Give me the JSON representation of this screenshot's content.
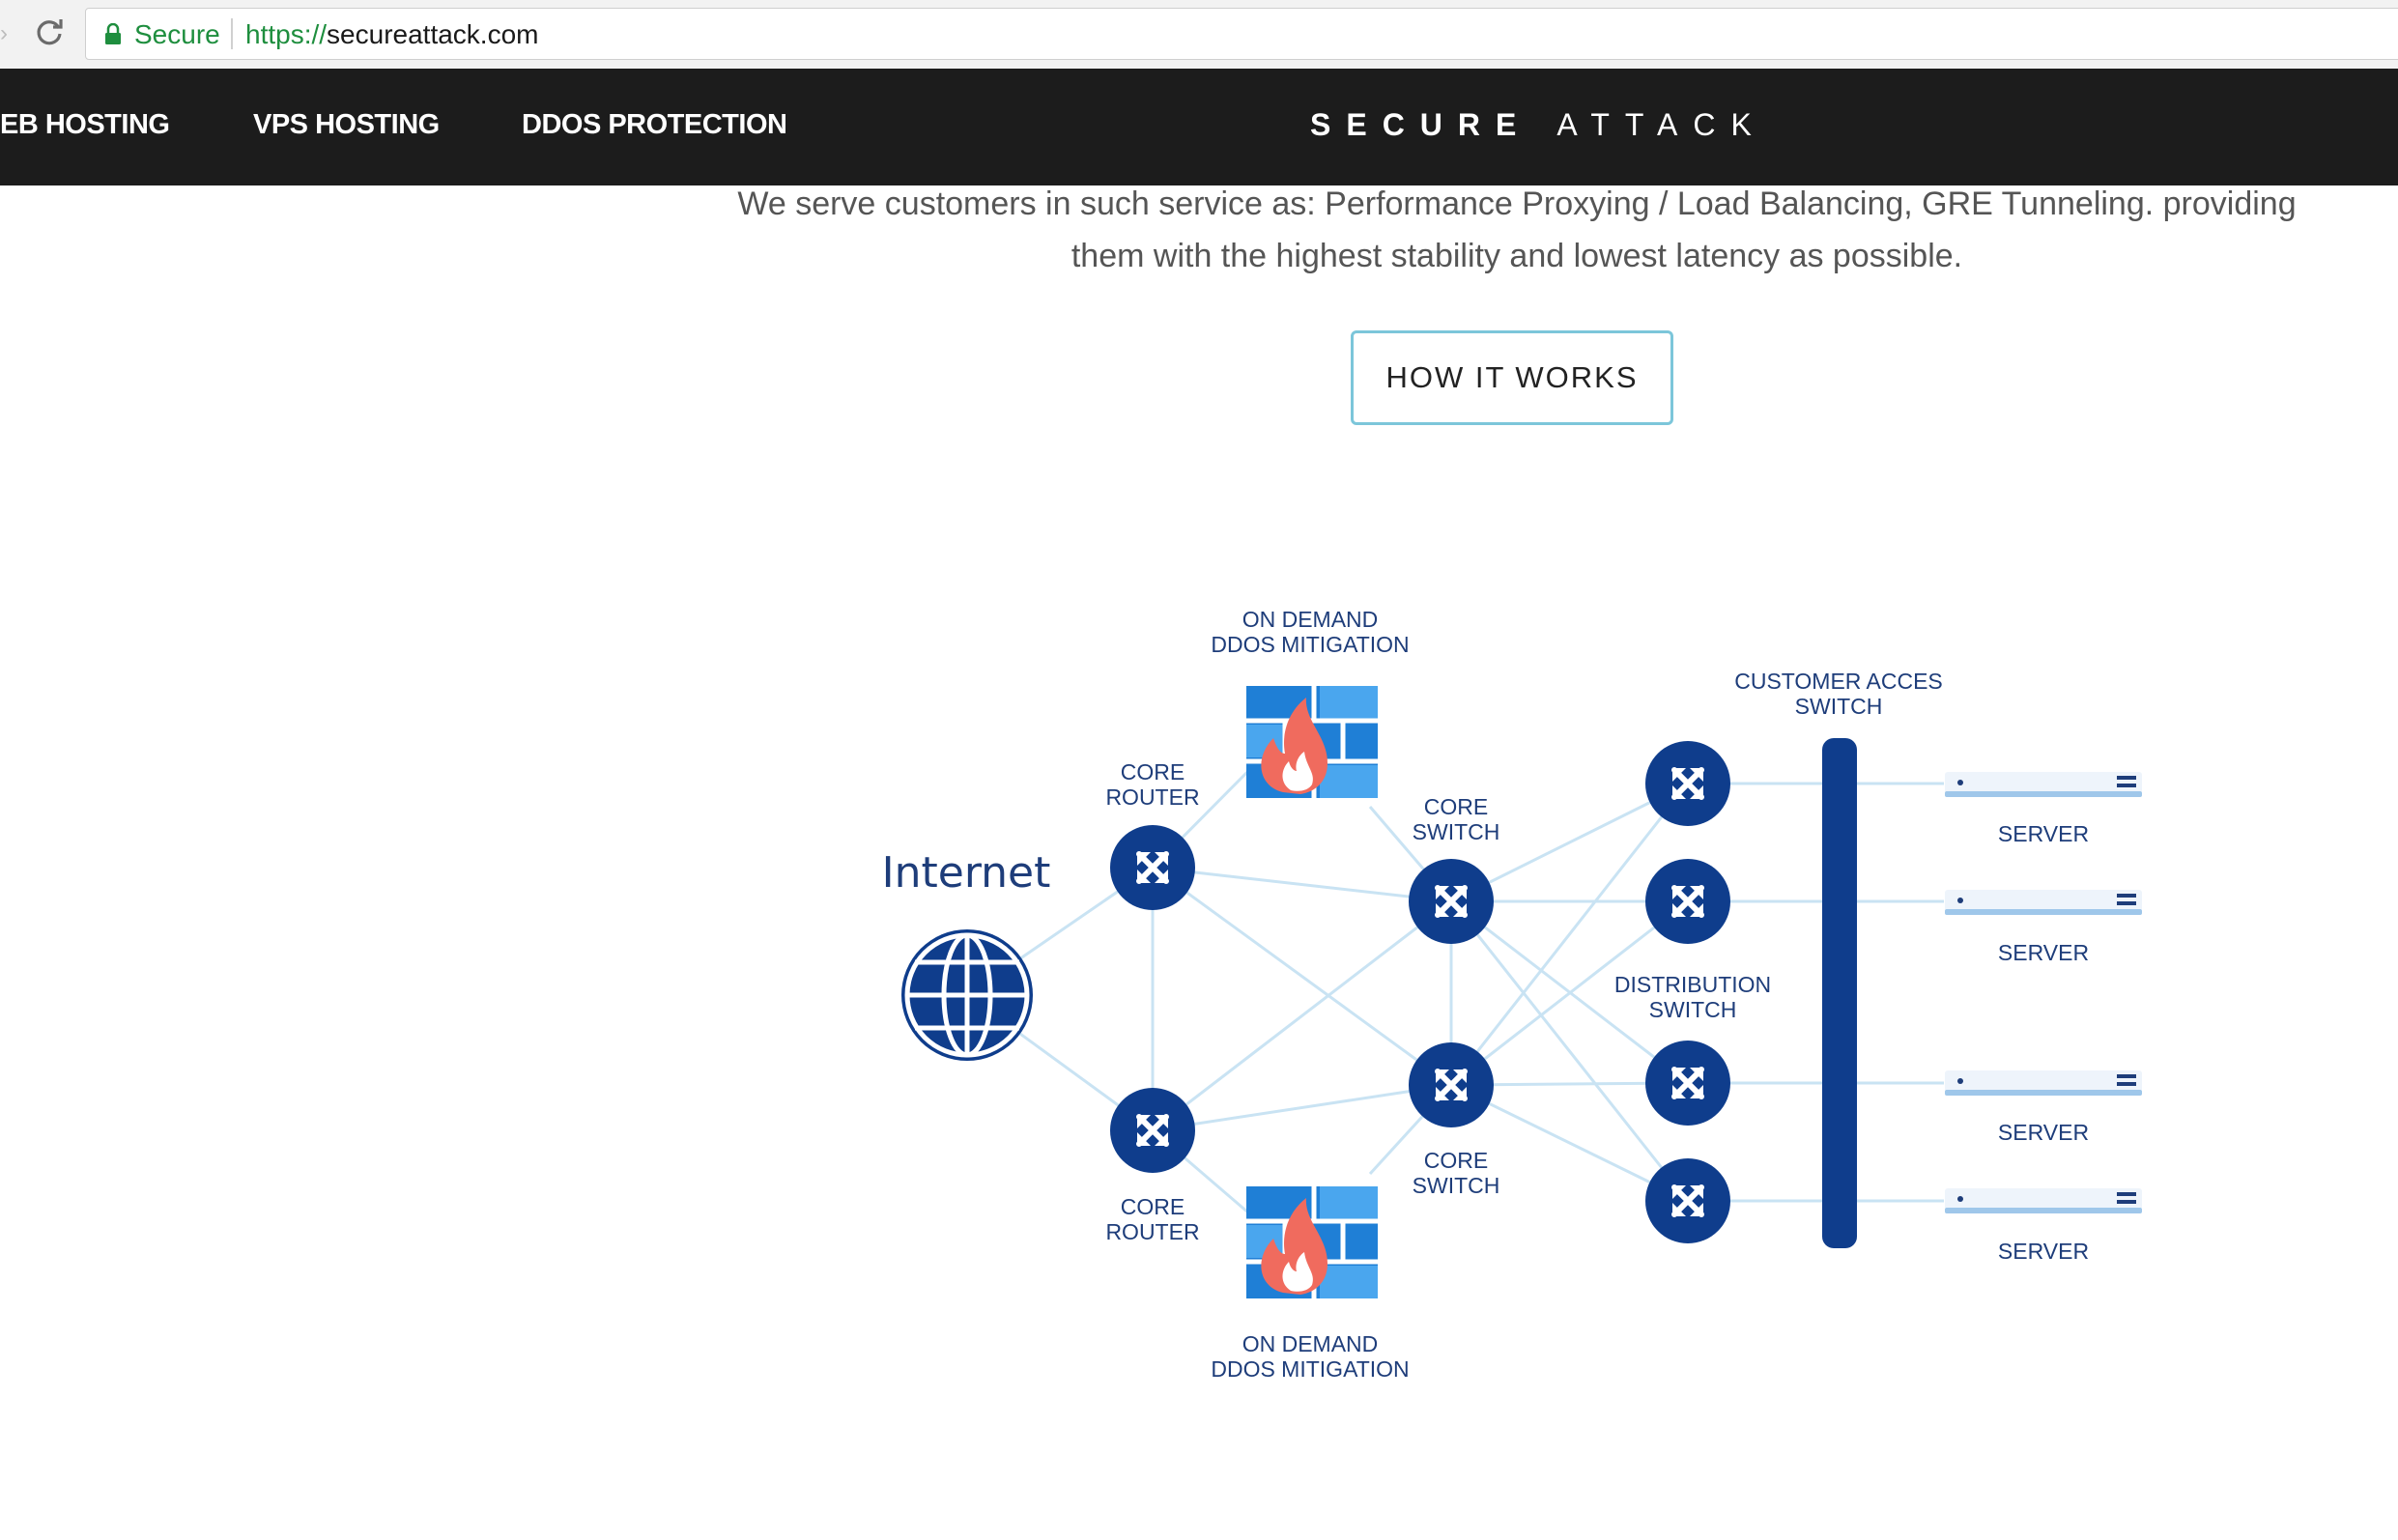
{
  "browser": {
    "secure_label": "Secure",
    "url_scheme": "https://",
    "url_host": "secureattack.com"
  },
  "nav": {
    "items": [
      "EB HOSTING",
      "VPS HOSTING",
      "DDOS PROTECTION"
    ],
    "brand_bold": "SECURE",
    "brand_light": "ATTACK"
  },
  "intro": {
    "line1": "We serve customers in such service as: Performance Proxying / Load Balancing, GRE Tunneling. providing",
    "line2": "them with the highest stability and lowest latency as possible."
  },
  "cta_label": "HOW IT WORKS",
  "diagram": {
    "internet": "Internet",
    "mitigation_top": [
      "ON DEMAND",
      "DDOS MITIGATION"
    ],
    "mitigation_bottom": [
      "ON DEMAND",
      "DDOS MITIGATION"
    ],
    "core_router_top": [
      "CORE",
      "ROUTER"
    ],
    "core_router_bottom": [
      "CORE",
      "ROUTER"
    ],
    "core_switch_top": [
      "CORE",
      "SWITCH"
    ],
    "core_switch_bottom": [
      "CORE",
      "SWITCH"
    ],
    "distribution_switch": [
      "DISTRIBUTION",
      "SWITCH"
    ],
    "customer_access_switch": [
      "CUSTOMER ACCES",
      "SWITCH"
    ],
    "servers": [
      "SERVER",
      "SERVER",
      "SERVER",
      "SERVER"
    ]
  },
  "colors": {
    "nav_bg": "#1c1c1c",
    "node_blue": "#0f3d8c",
    "link_blue": "#c9e3f3",
    "cta_border": "#7cc6da",
    "flame": "#f06b5e"
  }
}
